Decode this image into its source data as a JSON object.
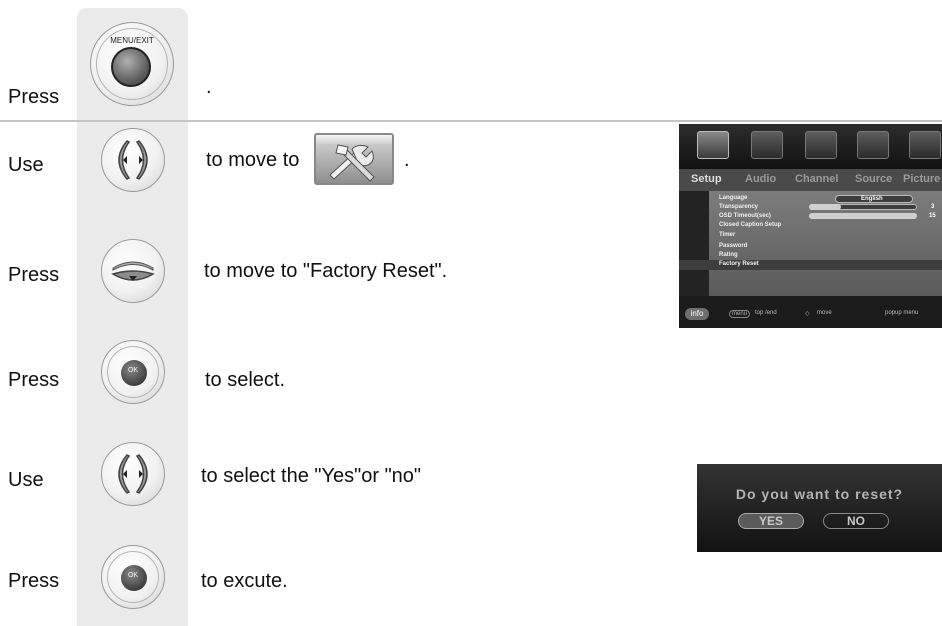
{
  "steps": [
    {
      "action": "Press",
      "button": "menu-exit",
      "button_label": "MENU/EXIT",
      "text": "."
    },
    {
      "action": "Use",
      "button": "left-right",
      "text": "to move to",
      "suffix": "."
    },
    {
      "action": "Press",
      "button": "down",
      "text": "to move to  \"Factory Reset\"."
    },
    {
      "action": "Press",
      "button": "ok",
      "button_label": "OK",
      "text": "to select."
    },
    {
      "action": "Use",
      "button": "left-right",
      "text": "to select the \"Yes\"or \"no\""
    },
    {
      "action": "Press",
      "button": "ok",
      "button_label": "OK",
      "text": "to excute."
    }
  ],
  "tv_menu": {
    "tabs": [
      "Setup",
      "Audio",
      "Channel",
      "Source",
      "Picture"
    ],
    "active_tab": "Setup",
    "items": [
      {
        "label": "Language",
        "value": "English"
      },
      {
        "label": "Transparency",
        "value": "3",
        "level": 0.3
      },
      {
        "label": "OSD Timeout(sec)",
        "value": "15",
        "level": 1.0
      },
      {
        "label": "Closed Caption Setup"
      },
      {
        "label": "Timer"
      },
      {
        "label": "Password"
      },
      {
        "label": "Rating"
      },
      {
        "label": "Factory Reset",
        "highlighted": true
      }
    ],
    "footer": {
      "info": "info",
      "menu_key": "menu",
      "hint1": "top /end",
      "hint2": "move",
      "hint3": "popup menu"
    }
  },
  "dialog": {
    "question": "Do you want to reset?",
    "yes": "YES",
    "no": "NO",
    "selected": "YES"
  },
  "colors": {
    "column": "#ebebeb",
    "rule": "#c4c4c4"
  }
}
